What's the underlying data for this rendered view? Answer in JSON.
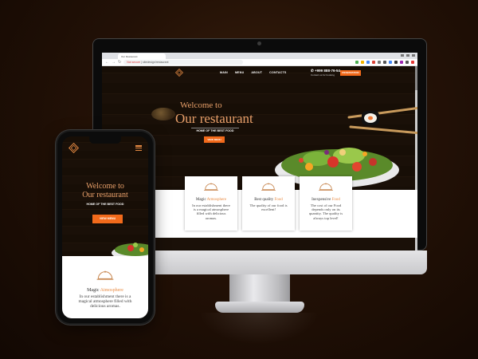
{
  "browser": {
    "tab_title": "Our Restaurant",
    "url_prefix": "Not secure",
    "url": "sitedesign/restaurant"
  },
  "site": {
    "menu": [
      "MAIN",
      "MENU",
      "ABOUT",
      "CONTACTS"
    ],
    "phone": "+999 888-76-54",
    "phone_sub": "Contact us for booking",
    "reserve_label": "RESERVATION",
    "hero": {
      "welcome": "Welcome to",
      "title": "Our restaurant",
      "subtitle": "HOME OF THE BEST FOOD",
      "button": "VIEW MENU"
    },
    "features": [
      {
        "title_plain": "Magic ",
        "title_accent": "Atmosphere",
        "text": "In our establishment there is a magical atmosphere filled with delicious aromas."
      },
      {
        "title_plain": "Best quality ",
        "title_accent": "Food",
        "text": "The quality of our food is excellent!"
      },
      {
        "title_plain": "Inexpensive ",
        "title_accent": "Food",
        "text": "The cost of our Food depends only on its quantity. The quality is always top level!"
      }
    ]
  },
  "mobile": {
    "welcome": "Welcome to",
    "title": "Our restaurant",
    "subtitle": "HOME OF THE BEST FOOD",
    "button": "VIEW MENU",
    "feature": {
      "title_plain": "Magic ",
      "title_accent": "Atmosphere",
      "text": "In our establishment there is a magical atmosphere filled with delicious aromas."
    }
  },
  "colors": {
    "accent": "#f26a1b",
    "gold": "#e9a06a",
    "background": "#231106"
  },
  "icons": [
    "diamond-logo-icon",
    "cloche-icon",
    "hamburger-menu-icon",
    "salad-bowl-icon",
    "sushi-chopsticks-icon"
  ]
}
